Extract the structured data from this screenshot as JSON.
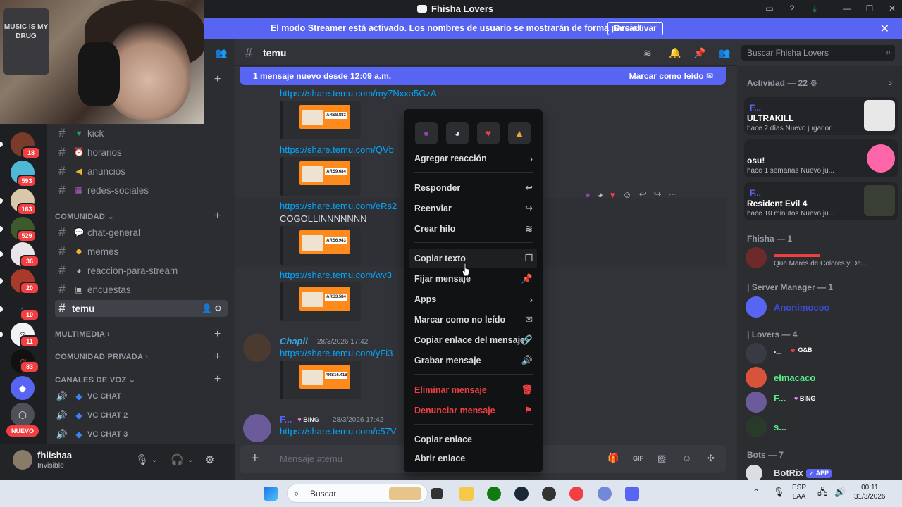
{
  "window": {
    "title": "Fhisha Lovers"
  },
  "banner": {
    "text": "El modo Streamer está activado. Los nombres de usuario se mostrarán de forma parcial.",
    "button": "Desactivar"
  },
  "webcam": {
    "shirt_text": "MUSIC IS MY DRUG"
  },
  "servers": [
    {
      "badge": "18"
    },
    {
      "badge": "593"
    },
    {
      "badge": "163"
    },
    {
      "badge": "529"
    },
    {
      "badge": "36"
    },
    {
      "badge": "20"
    },
    {
      "badge": "10"
    },
    {
      "badge": "11"
    },
    {
      "badge": "83"
    }
  ],
  "servers_new_label": "NUEVO",
  "channels": {
    "kick": "kick",
    "horarios": "horarios",
    "anuncios": "anuncios",
    "redes": "redes-sociales",
    "cat_comunidad": "COMUNIDAD",
    "chat_general": "chat-general",
    "memes": "memes",
    "reaccion": "reaccion-para-stream",
    "encuestas": "encuestas",
    "temu": "temu",
    "cat_multimedia": "MULTIMEDIA",
    "cat_privada": "COMUNIDAD PRIVADA",
    "cat_voz": "CANALES DE VOZ",
    "vc1": "VC CHAT",
    "vc2": "VC CHAT 2",
    "vc3": "VC CHAT 3"
  },
  "user": {
    "name": "fhiishaa",
    "status": "Invisible"
  },
  "chat": {
    "channel": "temu",
    "search_placeholder": "Buscar Fhisha Lovers",
    "new_messages": "1 mensaje nuevo desde 12:09 a.m.",
    "mark_read": "Marcar como leído",
    "composer_placeholder": "Mensaje #temu"
  },
  "messages": {
    "link1": "https://share.temu.com/my7Nxxa5GzA",
    "link2": "https://share.temu.com/QVb",
    "link3": "https://share.temu.com/eRs2",
    "text3": "COGOLLINNNNNNN",
    "link4": "https://share.temu.com/wv3",
    "author5": "Chapii",
    "time5": "28/3/2026 17:42",
    "link5": "https://share.temu.com/yFi3",
    "author6": "F...",
    "tag6": "BING",
    "time6": "28/3/2026 17:42",
    "link6": "https://share.temu.com/c57V",
    "prices": [
      "ARS8.883",
      "ARS9.684",
      "ARS6.943",
      "ARS3.584",
      "ARS16.416"
    ]
  },
  "context_menu": {
    "add_reaction": "Agregar reacción",
    "reply": "Responder",
    "forward": "Reenviar",
    "thread": "Crear hilo",
    "copy_text": "Copiar texto",
    "pin": "Fijar mensaje",
    "apps": "Apps",
    "mark_unread": "Marcar como no leído",
    "copy_message_link": "Copiar enlace del mensaje",
    "record": "Grabar mensaje",
    "delete": "Eliminar mensaje",
    "report": "Denunciar mensaje",
    "copy_link": "Copiar enlace",
    "open_link": "Abrir enlace"
  },
  "members": {
    "activity_header": "Actividad — 22",
    "cards": [
      {
        "name": "F...",
        "game": "ULTRAKILL",
        "sub": "hace 2 días   Nuevo jugador"
      },
      {
        "name": "",
        "game": "osu!",
        "sub": "hace 1 semanas   Nuevo ju..."
      },
      {
        "name": "F...",
        "game": "Resident Evil 4",
        "sub": "hace 10 minutos   Nuevo ju..."
      }
    ],
    "fhisha_header": "Fhisha — 1",
    "fhisha_status": "Que Mares de Colores y De...",
    "manager_header": "| Server Manager — 1",
    "manager_name": "Anonimocoo",
    "lovers_header": "| Lovers — 4",
    "lovers": [
      {
        "name": "._",
        "tag": "G&B"
      },
      {
        "name": "elmacaco",
        "tag": ""
      },
      {
        "name": "F...",
        "tag": "BING"
      },
      {
        "name": "s...",
        "tag": ""
      }
    ],
    "bots_header": "Bots — 7",
    "bot_name": "BotRix",
    "bot_tag": "APP"
  },
  "taskbar": {
    "search": "Buscar",
    "lang1": "ESP",
    "lang2": "LAA",
    "time": "00:11",
    "date": "31/3/2026"
  }
}
